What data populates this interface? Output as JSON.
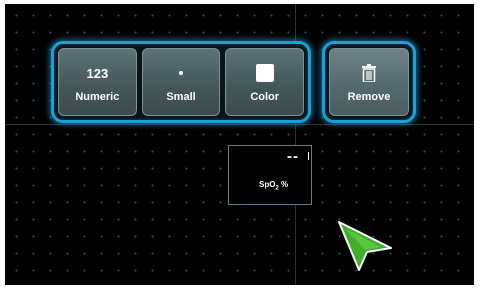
{
  "toolbar": {
    "numeric": {
      "glyph": "123",
      "label": "Numeric"
    },
    "small": {
      "label": "Small"
    },
    "color": {
      "label": "Color"
    },
    "remove": {
      "label": "Remove"
    }
  },
  "parameter": {
    "value": "--",
    "label_main": "SpO",
    "label_sub": "2",
    "label_unit": " %"
  },
  "colors": {
    "accent_glow": "#1c9fd6",
    "cursor": "#3fae2a",
    "background": "#000000"
  },
  "icons": {
    "remove": "trash-icon",
    "small": "dot-icon",
    "color": "white-square-icon",
    "pointer": "cursor-arrow-icon"
  }
}
